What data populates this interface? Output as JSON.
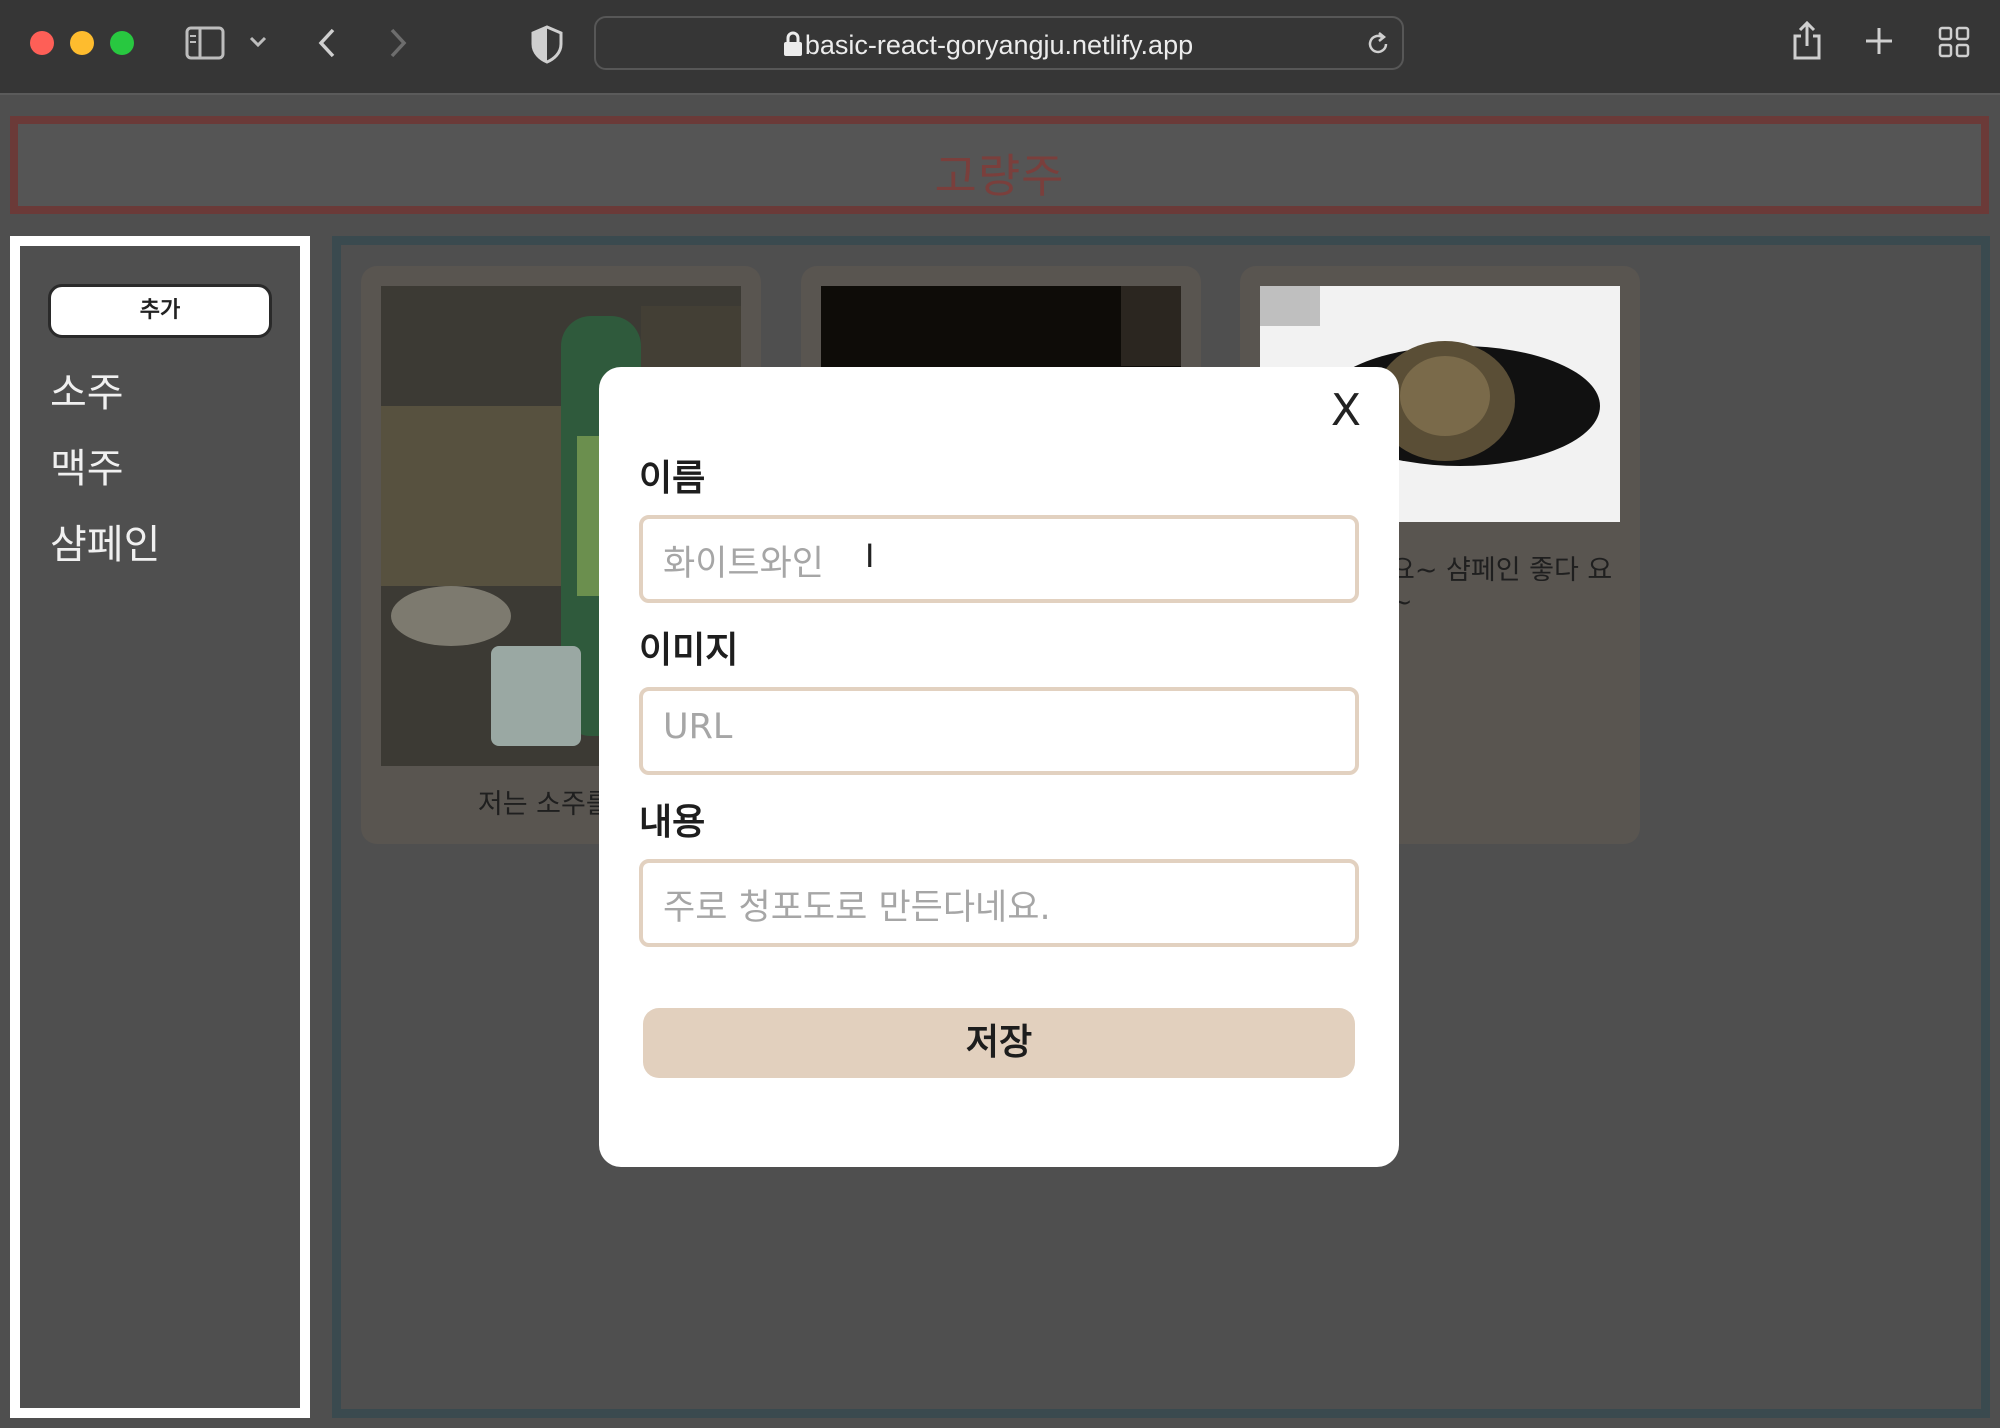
{
  "browser": {
    "url": "basic-react-goryangju.netlify.app"
  },
  "header": {
    "title": "고량주"
  },
  "sidebar": {
    "add_label": "추가",
    "categories": [
      {
        "label": "소주"
      },
      {
        "label": "맥주"
      },
      {
        "label": "샴페인"
      }
    ]
  },
  "cards": [
    {
      "text": "저는 소주를 안"
    },
    {
      "text": ""
    },
    {
      "text": "요~ 샴페인 좋다 요~"
    }
  ],
  "modal": {
    "close_label": "X",
    "name_label": "이름",
    "name_placeholder": "화이트와인",
    "image_label": "이미지",
    "image_placeholder": "URL",
    "content_label": "내용",
    "content_placeholder": "주로 청포도로 만든다네요.",
    "save_label": "저장"
  }
}
